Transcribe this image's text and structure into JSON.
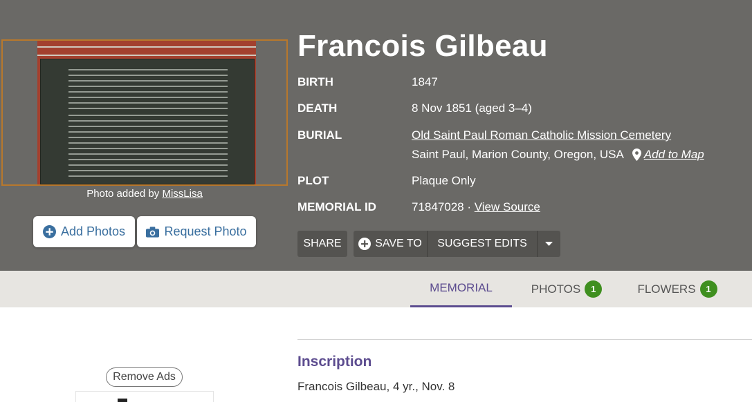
{
  "memorial": {
    "name": "Francois Gilbeau",
    "photo_credit_prefix": "Photo added by ",
    "photo_credit_user": "MissLisa",
    "add_photos": "Add Photos",
    "request_photo": "Request Photo",
    "birth_label": "BIRTH",
    "birth_value": "1847",
    "death_label": "DEATH",
    "death_value": "8 Nov 1851 (aged 3–4)",
    "burial_label": "BURIAL",
    "burial_cemetery": "Old Saint Paul Roman Catholic Mission Cemetery",
    "burial_location": "Saint Paul, Marion County, Oregon, USA",
    "add_to_map": "Add to Map",
    "plot_label": "PLOT",
    "plot_value": "Plaque Only",
    "id_label": "MEMORIAL ID",
    "id_value": "71847028 · ",
    "view_source": "View Source"
  },
  "actions": {
    "share": "SHARE",
    "save_to": "SAVE TO",
    "suggest_edits": "SUGGEST EDITS"
  },
  "tabs": [
    {
      "label": "MEMORIAL",
      "count": null,
      "active": true
    },
    {
      "label": "PHOTOS",
      "count": "1",
      "active": false
    },
    {
      "label": "FLOWERS",
      "count": "1",
      "active": false
    }
  ],
  "inscription": {
    "heading": "Inscription",
    "text": "Francois Gilbeau, 4 yr., Nov. 8"
  },
  "ads": {
    "remove_ads": "Remove Ads"
  },
  "icons": {
    "add_photos": "plus-circle-icon",
    "request_photo": "camera-icon",
    "map": "map-pin-icon",
    "save_to": "plus-circle-icon",
    "dropdown": "caret-down-icon"
  },
  "colors": {
    "hero_bg": "#6a6966",
    "accent_purple": "#5c4c8f",
    "badge_green": "#3f8f1f",
    "link_blue": "#3a6f9f"
  }
}
